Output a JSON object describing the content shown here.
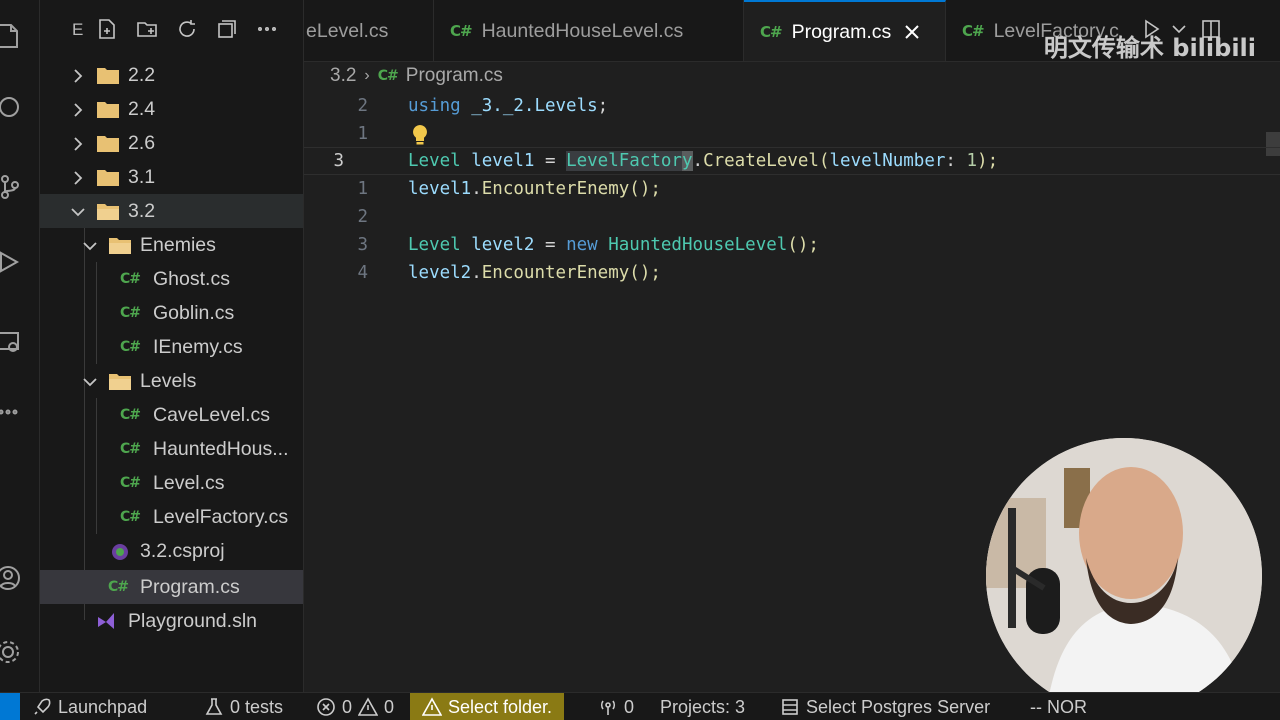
{
  "activity_bar": {
    "icons": [
      "explorer-icon",
      "search-icon",
      "source-control-icon",
      "run-debug-icon",
      "remote-explorer-icon",
      "more-icon",
      "account-icon",
      "settings-gear-icon"
    ]
  },
  "sidebar": {
    "title": "E",
    "toolbar": [
      "new-file-icon",
      "new-folder-icon",
      "refresh-icon",
      "collapse-all-icon",
      "more-actions-icon"
    ],
    "tree": [
      {
        "label": "2.2",
        "type": "folder",
        "expanded": false
      },
      {
        "label": "2.4",
        "type": "folder",
        "expanded": false
      },
      {
        "label": "2.6",
        "type": "folder",
        "expanded": false
      },
      {
        "label": "3.1",
        "type": "folder",
        "expanded": false
      },
      {
        "label": "3.2",
        "type": "folder",
        "expanded": true
      },
      {
        "label": "Enemies",
        "type": "folder",
        "expanded": true
      },
      {
        "label": "Ghost.cs",
        "type": "cs"
      },
      {
        "label": "Goblin.cs",
        "type": "cs"
      },
      {
        "label": "IEnemy.cs",
        "type": "cs"
      },
      {
        "label": "Levels",
        "type": "folder",
        "expanded": true
      },
      {
        "label": "CaveLevel.cs",
        "type": "cs"
      },
      {
        "label": "HauntedHous...",
        "type": "cs"
      },
      {
        "label": "Level.cs",
        "type": "cs"
      },
      {
        "label": "LevelFactory.cs",
        "type": "cs"
      },
      {
        "label": "3.2.csproj",
        "type": "csproj"
      },
      {
        "label": "Program.cs",
        "type": "cs"
      },
      {
        "label": "Playground.sln",
        "type": "sln"
      }
    ]
  },
  "tabs": [
    {
      "label": "eLevel.cs",
      "icon": "C#",
      "active": false
    },
    {
      "label": "HauntedHouseLevel.cs",
      "icon": "C#",
      "active": false
    },
    {
      "label": "Program.cs",
      "icon": "C#",
      "active": true
    },
    {
      "label": "LevelFactory.c",
      "icon": "C#",
      "active": false
    }
  ],
  "watermark": "明文传输术 bilibili",
  "breadcrumb": {
    "folder": "3.2",
    "file_icon": "C#",
    "file": "Program.cs"
  },
  "editor": {
    "line_numbers": [
      "2",
      "1",
      "3",
      "1",
      "2",
      "3",
      "4"
    ],
    "lines": {
      "l1": {
        "kw": "using",
        "ns": " _3._2.Levels",
        "end": ";"
      },
      "l3": {
        "t1": "Level",
        "v1": " level1 ",
        "eq": "= ",
        "cls": "LevelFactor",
        "cur": "y",
        "dot": ".",
        "fn": "CreateLevel",
        "p1": "(",
        "param": "levelNumber",
        "colon": ": ",
        "num": "1",
        "p2": ");"
      },
      "l4": {
        "v": "level1",
        "dot": ".",
        "fn": "EncounterEnemy",
        "p": "();"
      },
      "l6": {
        "t": "Level",
        "v": " level2 ",
        "eq": "= ",
        "kw": "new",
        "cls": " HauntedHouseLevel",
        "p": "();"
      },
      "l7": {
        "v": "level2",
        "dot": ".",
        "fn": "EncounterEnemy",
        "p": "();"
      }
    }
  },
  "statusbar": {
    "launchpad": "Launchpad",
    "tests": "0 tests",
    "errors": "0",
    "warnings": "0",
    "select_folder": "Select folder.",
    "ports": "0",
    "projects": "Projects: 3",
    "postgres": "Select Postgres Server",
    "mode": "-- NOR"
  }
}
